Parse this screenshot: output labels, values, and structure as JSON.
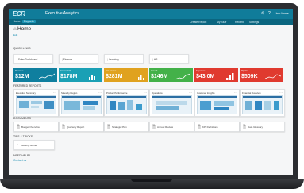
{
  "app": {
    "logo": "ECR",
    "title": "Executive Analytics"
  },
  "topbar": {
    "icons": [
      "gear-icon",
      "help-icon"
    ],
    "user_label": "User Name"
  },
  "tabs": [
    {
      "label": "Home",
      "active": false
    },
    {
      "label": "Reports",
      "active": true
    }
  ],
  "right_links": [
    "Create Report",
    "My Stuff",
    "Recent",
    "Settings"
  ],
  "page": {
    "title": "Home",
    "subtitle": "Edit"
  },
  "sections": {
    "quick_links": "QUICK LINKS",
    "kpis": "KPIs",
    "reports": "FEATURED REPORTS",
    "documents": "DOCUMENTS",
    "tips": "TIPS & TRICKS",
    "help": "NEED HELP?",
    "help_sub": "Contact us"
  },
  "quick_links": [
    "Sales Dashboard",
    "Finance",
    "Inventory",
    "HR"
  ],
  "kpis": [
    {
      "label": "Revenue",
      "value": "$12M",
      "color": "#0f7f9f",
      "chart": "line"
    },
    {
      "label": "Gross Profit",
      "value": "$178M",
      "color": "#1aa0b5",
      "chart": "bars"
    },
    {
      "label": "Net Income",
      "value": "$281M",
      "color": "#e0a21f",
      "chart": "bars"
    },
    {
      "label": "Growth",
      "value": "$146M",
      "color": "#43b149",
      "chart": "line"
    },
    {
      "label": "Expenses",
      "value": "$43.0M",
      "color": "#e03a2f",
      "chart": "bars"
    },
    {
      "label": "Pipeline",
      "value": "$509K",
      "color": "#e03a2f",
      "chart": "line"
    }
  ],
  "reports": [
    "Executive Summary",
    "Sales by Region",
    "Product Performance",
    "Operations",
    "Customer Insights",
    "Financial Overview"
  ],
  "documents": [
    "Budget Overview",
    "Quarterly Report",
    "Strategic Plan",
    "Annual Review",
    "KPI Definitions",
    "Data Glossary"
  ],
  "tips_item": "Getting Started"
}
